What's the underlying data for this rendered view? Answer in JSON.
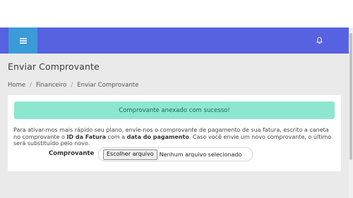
{
  "navbar": {
    "menu_icon": "hamburger-menu-icon",
    "notification_icon": "bell-icon",
    "colors": {
      "navbar": "#5662e0",
      "menu_button": "#3b9ad8"
    }
  },
  "page": {
    "title": "Enviar Comprovante"
  },
  "breadcrumb": {
    "items": [
      "Home",
      "Financeiro",
      "Enviar Comprovante"
    ]
  },
  "alert": {
    "message": "Comprovante anexado com sucesso!",
    "color": "#8de6d0"
  },
  "instructions": {
    "part1": "Para ativar-mos mais rápido seu plano, envie-nos o comprovante de pagamento de sua fatura, escrito a caneta no comprovante o ",
    "bold1": "ID da Fatura",
    "part2": " com a ",
    "bold2": "data do pagamento",
    "part3": ". Caso você envie um novo comprovante, o último será substituído pelo novo."
  },
  "form": {
    "label": "Comprovante",
    "file_button": "Escolher arquivo",
    "file_status": "Nenhum arquivo selecionado"
  }
}
